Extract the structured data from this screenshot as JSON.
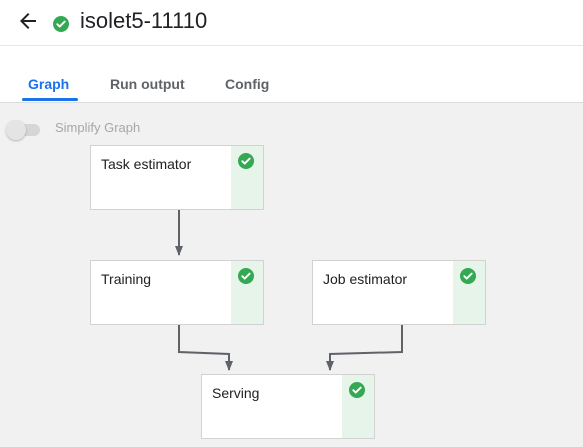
{
  "header": {
    "title": "isolet5-11110",
    "status": "succeeded",
    "status_color": "#34a853"
  },
  "tabs": [
    {
      "label": "Graph",
      "active": true
    },
    {
      "label": "Run output",
      "active": false
    },
    {
      "label": "Config",
      "active": false
    }
  ],
  "graph": {
    "simplify_label": "Simplify Graph",
    "simplify_enabled": false,
    "nodes": [
      {
        "id": "task-estimator",
        "label": "Task estimator",
        "status": "succeeded"
      },
      {
        "id": "training",
        "label": "Training",
        "status": "succeeded"
      },
      {
        "id": "job-estimator",
        "label": "Job estimator",
        "status": "succeeded"
      },
      {
        "id": "serving",
        "label": "Serving",
        "status": "succeeded"
      }
    ],
    "edges": [
      {
        "from": "task-estimator",
        "to": "training"
      },
      {
        "from": "training",
        "to": "serving"
      },
      {
        "from": "job-estimator",
        "to": "serving"
      }
    ]
  },
  "colors": {
    "accent": "#1a73e8",
    "success": "#34a853",
    "success_bg": "#e6f4ea",
    "edge": "#5f6368"
  }
}
